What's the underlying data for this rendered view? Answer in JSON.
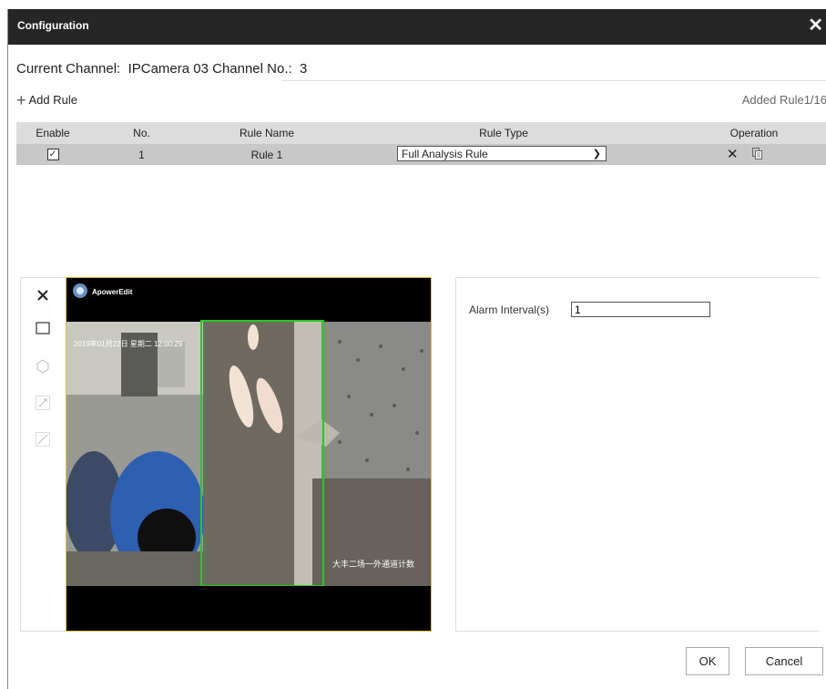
{
  "dialog": {
    "title": "Configuration"
  },
  "channel": {
    "text": "Current Channel:  IPCamera 03 Channel No.:  3"
  },
  "toolbar": {
    "add_rule": "Add Rule",
    "added_count": "Added Rule1/16"
  },
  "table": {
    "headers": [
      "Enable",
      "No.",
      "Rule Name",
      "Rule Type",
      "Operation"
    ],
    "rows": [
      {
        "enabled": true,
        "no": "1",
        "name": "Rule 1",
        "type": "Full Analysis Rule"
      }
    ]
  },
  "video": {
    "app_label": "ApowerEdit",
    "timestamp": "2019年01月22日 星期二 12:00:29",
    "caption": "大丰二场一外通道计数"
  },
  "params": {
    "alarm_interval_label": "Alarm Interval(s)",
    "alarm_interval_value": "1"
  },
  "footer": {
    "ok": "OK",
    "cancel": "Cancel"
  },
  "colors": {
    "titlebar": "#262626",
    "header_row": "#dcdcdc",
    "selected_row": "#c8c8c8",
    "roi_box": "#22cc22",
    "video_border": "#e0c040"
  }
}
